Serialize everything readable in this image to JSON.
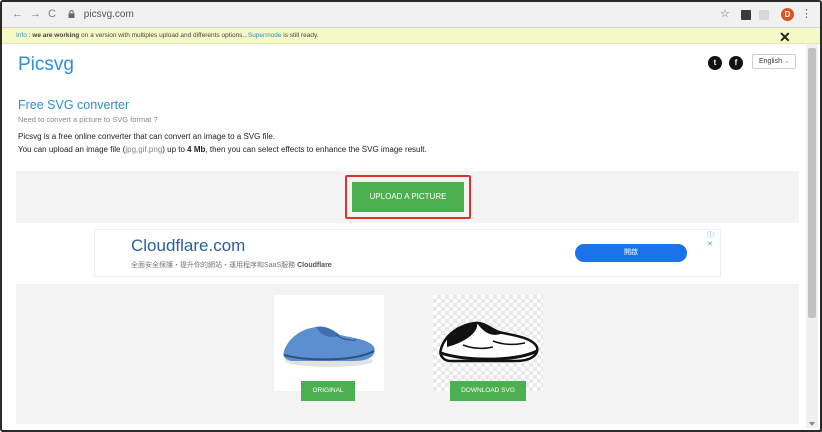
{
  "browser": {
    "back": "←",
    "forward": "→",
    "reload": "C",
    "url": "picsvg.com",
    "star": "☆",
    "menu": "⋮",
    "profile_initial": "D"
  },
  "infobar": {
    "label": "Info",
    "sep": " : ",
    "bold": "we are working",
    "text": " on a version with multiples upload and differents options...",
    "link": "Supermode",
    "tail": " is still ready.",
    "close": "✕"
  },
  "header": {
    "logo": "Picsvg",
    "twitter": "t",
    "facebook": "f",
    "language": "English",
    "language_caret": "⌄"
  },
  "main": {
    "title": "Free SVG converter",
    "subtitle": "Need to convert a picture to SVG format ?",
    "p1": "Picsvg is a free online converter that can convert an image to a SVG file.",
    "p2_a": "You can upload an image file (",
    "p2_formats": "jpg,gif,png",
    "p2_b": ") up to ",
    "p2_size": "4 Mb",
    "p2_c": ", then you can select effects to enhance the SVG image result.",
    "upload_label": "UPLOAD A PICTURE"
  },
  "ad": {
    "title": "Cloudflare.com",
    "sub_text": "全面安全保護・提升你的網站・運用程序和SaaS服務 ",
    "sub_bold": "Cloudflare",
    "button": "開啟",
    "choices": "ⓘ ✕"
  },
  "gallery": {
    "original_label": "ORIGINAL",
    "download_label": "DOWNLOAD SVG"
  },
  "colors": {
    "accent": "#2f8fd1",
    "green": "#4caf50",
    "highlight": "#e03030",
    "shoe_blue": "#5b8fd0"
  }
}
